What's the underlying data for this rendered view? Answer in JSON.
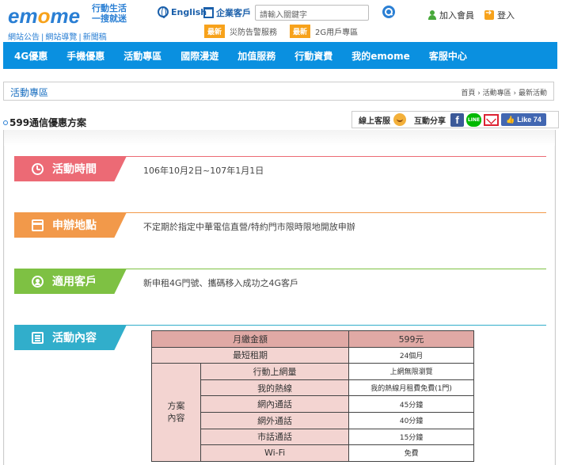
{
  "header": {
    "logo_prefix": "em",
    "logo_o": "o",
    "logo_suffix": "me",
    "slogan_line1": "行動生活",
    "slogan_line2": "一搜就迷",
    "links": [
      "網站公告",
      "網站導覽",
      "新聞稿"
    ],
    "english": "English",
    "enterprise": "企業客戶",
    "search_placeholder": "請輸入關鍵字",
    "news": [
      {
        "badge": "最新",
        "text": "災防告警服務"
      },
      {
        "badge": "最新",
        "text": "2G用戶專區"
      }
    ],
    "join": "加入會員",
    "login": "登入"
  },
  "nav": [
    "4G優惠",
    "手機優惠",
    "活動專區",
    "國際漫遊",
    "加值服務",
    "行動資費",
    "我的emome",
    "客服中心"
  ],
  "breadcrumb": {
    "section": "活動專區",
    "path": "首頁 › 活動專區 › 最新活動"
  },
  "page": {
    "title": "599通信優惠方案",
    "online_service": "線上客服",
    "share": "互動分享",
    "line_label": "LINE",
    "like": "Like 74"
  },
  "sections": [
    {
      "label": "活動時間",
      "icon": "clock-icon",
      "color": "#ec6a75",
      "text": "106年10月2日~107年1月1日"
    },
    {
      "label": "申辦地點",
      "icon": "store-icon",
      "color": "#f2994a",
      "text": "不定期於指定中華電信直營/特約門市限時限地開放申辦"
    },
    {
      "label": "適用客戶",
      "icon": "user-icon",
      "color": "#7ec143",
      "text": "新申租4G門號、攜碼移入成功之4G客戶"
    },
    {
      "label": "活動內容",
      "icon": "list-icon",
      "color": "#31aecb",
      "text": ""
    }
  ],
  "plan_table": {
    "monthly_label": "月繳金額",
    "monthly_value": "599元",
    "min_term_label": "最短租期",
    "min_term_value": "24個月",
    "group_label_1": "方案",
    "group_label_2": "內容",
    "rows": [
      {
        "label": "行動上網量",
        "value": "上網無限瀏覽"
      },
      {
        "label": "我的熱線",
        "value": "我的熱線月租費免費(1門)"
      },
      {
        "label": "網內通話",
        "value": "45分鐘"
      },
      {
        "label": "網外通話",
        "value": "40分鐘"
      },
      {
        "label": "市話通話",
        "value": "15分鐘"
      },
      {
        "label": "Wi-Fi",
        "value": "免費"
      }
    ]
  }
}
